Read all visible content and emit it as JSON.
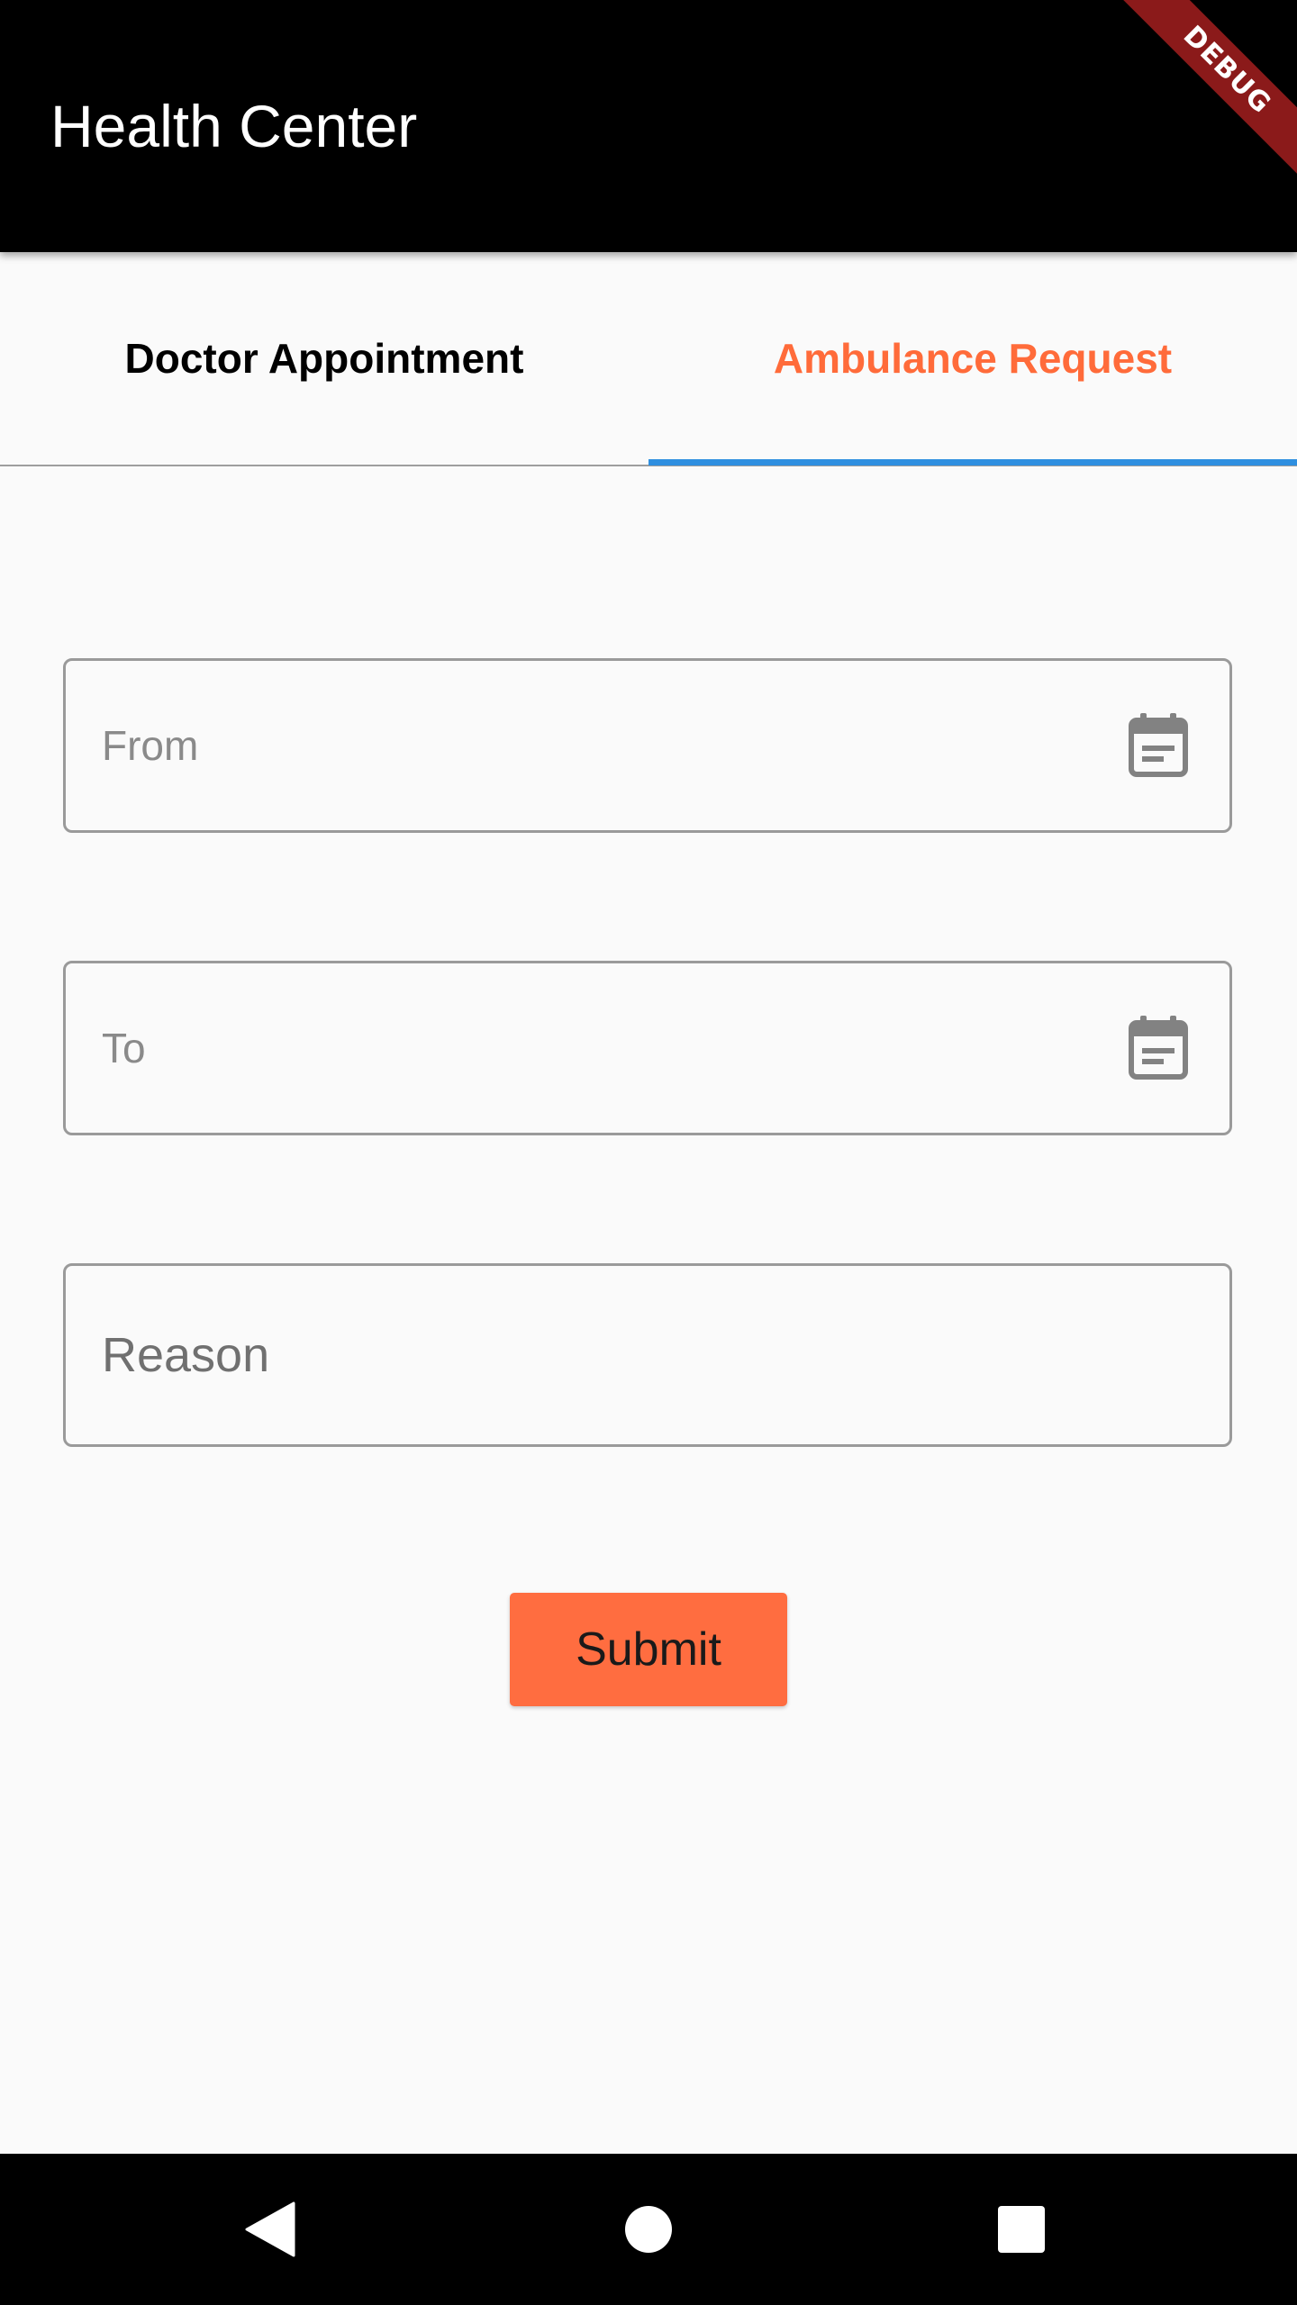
{
  "app_bar": {
    "title": "Health Center",
    "debug_label": "DEBUG"
  },
  "tabs": [
    {
      "label": "Doctor Appointment",
      "selected": false
    },
    {
      "label": "Ambulance Request",
      "selected": true
    }
  ],
  "form": {
    "from_label": "From",
    "from_icon": "calendar-icon",
    "to_label": "To",
    "to_icon": "calendar-icon",
    "reason_label": "Reason",
    "submit_label": "Submit"
  },
  "colors": {
    "accent": "#ff6b3a",
    "submit_button": "#ff6d40",
    "tab_indicator": "#2f8fe0",
    "app_bar": "#000000",
    "debug_ribbon": "#8b1a1a"
  },
  "nav_bar": {
    "icons": [
      "back-triangle-icon",
      "home-circle-icon",
      "recents-square-icon"
    ]
  }
}
